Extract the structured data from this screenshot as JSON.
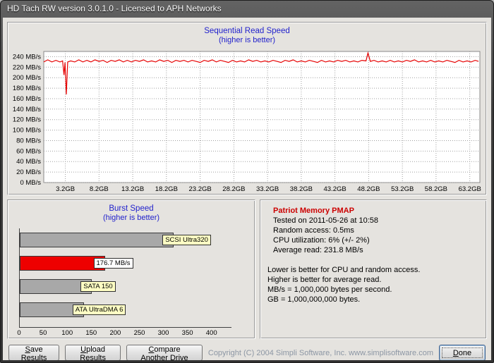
{
  "window": {
    "title": "HD Tach RW version 3.0.1.0 - Licensed to APH Networks"
  },
  "chart_data": [
    {
      "type": "line",
      "title": "Sequential Read Speed",
      "subtitle": "(higher is better)",
      "unit": "MB/s",
      "ylim": [
        0,
        250
      ],
      "yticks": [
        240,
        220,
        200,
        180,
        160,
        140,
        120,
        100,
        80,
        60,
        40,
        20,
        0
      ],
      "xlim": [
        0,
        64.7
      ],
      "xticks": [
        {
          "label": "3.2GB",
          "value": 3.2
        },
        {
          "label": "8.2GB",
          "value": 8.2
        },
        {
          "label": "13.2GB",
          "value": 13.2
        },
        {
          "label": "18.2GB",
          "value": 18.2
        },
        {
          "label": "23.2GB",
          "value": 23.2
        },
        {
          "label": "28.2GB",
          "value": 28.2
        },
        {
          "label": "33.2GB",
          "value": 33.2
        },
        {
          "label": "38.2GB",
          "value": 38.2
        },
        {
          "label": "43.2GB",
          "value": 43.2
        },
        {
          "label": "48.2GB",
          "value": 48.2
        },
        {
          "label": "53.2GB",
          "value": 53.2
        },
        {
          "label": "58.2GB",
          "value": 58.2
        },
        {
          "label": "63.2GB",
          "value": 63.2
        }
      ],
      "line_color": "#e60000",
      "grid": true,
      "points": [
        [
          0,
          230
        ],
        [
          0.6,
          234
        ],
        [
          1.2,
          230
        ],
        [
          1.8,
          233
        ],
        [
          2.4,
          230
        ],
        [
          2.8,
          232
        ],
        [
          3.0,
          205
        ],
        [
          3.15,
          229
        ],
        [
          3.35,
          168
        ],
        [
          3.55,
          230
        ],
        [
          4,
          232
        ],
        [
          4.6,
          230
        ],
        [
          5.2,
          234
        ],
        [
          5.8,
          230
        ],
        [
          6.4,
          233
        ],
        [
          7,
          230
        ],
        [
          7.6,
          234
        ],
        [
          8.2,
          231
        ],
        [
          8.8,
          233
        ],
        [
          9.4,
          229
        ],
        [
          10,
          233
        ],
        [
          10.6,
          231
        ],
        [
          11.2,
          234
        ],
        [
          11.8,
          230
        ],
        [
          12.4,
          233
        ],
        [
          13,
          230
        ],
        [
          13.6,
          233
        ],
        [
          14.2,
          231
        ],
        [
          14.8,
          234
        ],
        [
          15.4,
          230
        ],
        [
          16,
          232
        ],
        [
          16.6,
          230
        ],
        [
          17.2,
          234
        ],
        [
          17.8,
          231
        ],
        [
          18.4,
          233
        ],
        [
          19,
          229
        ],
        [
          19.6,
          233
        ],
        [
          20.2,
          231
        ],
        [
          20.8,
          233
        ],
        [
          21.4,
          230
        ],
        [
          22,
          233
        ],
        [
          22.6,
          231
        ],
        [
          23.2,
          229
        ],
        [
          23.8,
          233
        ],
        [
          24.4,
          231
        ],
        [
          25,
          234
        ],
        [
          25.6,
          230
        ],
        [
          26.2,
          233
        ],
        [
          26.8,
          231
        ],
        [
          27.4,
          229
        ],
        [
          28,
          233
        ],
        [
          28.6,
          230
        ],
        [
          29.2,
          232
        ],
        [
          29.8,
          230
        ],
        [
          30.4,
          234
        ],
        [
          31,
          231
        ],
        [
          31.6,
          233
        ],
        [
          32.2,
          230
        ],
        [
          32.8,
          232
        ],
        [
          33.4,
          230
        ],
        [
          34,
          233
        ],
        [
          34.6,
          231
        ],
        [
          35.2,
          229
        ],
        [
          35.8,
          233
        ],
        [
          36.4,
          231
        ],
        [
          37,
          234
        ],
        [
          37.6,
          230
        ],
        [
          38.2,
          232
        ],
        [
          38.8,
          230
        ],
        [
          39.4,
          233
        ],
        [
          40,
          231
        ],
        [
          40.6,
          229
        ],
        [
          41.2,
          233
        ],
        [
          41.8,
          230
        ],
        [
          42.4,
          232
        ],
        [
          43,
          230
        ],
        [
          43.6,
          233
        ],
        [
          44.2,
          231
        ],
        [
          44.8,
          233
        ],
        [
          45.4,
          230
        ],
        [
          46,
          232
        ],
        [
          46.6,
          230
        ],
        [
          47.2,
          233
        ],
        [
          47.8,
          232
        ],
        [
          48.1,
          247
        ],
        [
          48.45,
          231
        ],
        [
          49,
          233
        ],
        [
          49.6,
          230
        ],
        [
          50.2,
          232
        ],
        [
          50.8,
          230
        ],
        [
          51.4,
          233
        ],
        [
          52,
          230
        ],
        [
          52.6,
          232
        ],
        [
          53.2,
          230
        ],
        [
          53.8,
          233
        ],
        [
          54.4,
          231
        ],
        [
          55,
          234
        ],
        [
          55.6,
          230
        ],
        [
          56.2,
          232
        ],
        [
          56.8,
          230
        ],
        [
          57.4,
          233
        ],
        [
          58,
          230
        ],
        [
          58.6,
          232
        ],
        [
          59.2,
          230
        ],
        [
          59.8,
          233
        ],
        [
          60.4,
          231
        ],
        [
          61,
          229
        ],
        [
          61.6,
          233
        ],
        [
          62.2,
          230
        ],
        [
          62.8,
          232
        ],
        [
          63.4,
          230
        ],
        [
          64,
          233
        ],
        [
          64.5,
          231
        ]
      ]
    },
    {
      "type": "bar-horizontal",
      "title": "Burst Speed",
      "subtitle": "(higher is better)",
      "xlim": [
        0,
        440
      ],
      "xticks": [
        0,
        50,
        100,
        150,
        200,
        250,
        300,
        350,
        400
      ],
      "bars": [
        {
          "label": "SCSI Ultra320",
          "value": 320,
          "color": "#a8a8a8",
          "label_bg": "#ffffc4"
        },
        {
          "label": "176.7 MB/s",
          "value": 176.7,
          "color": "#ee0000",
          "label_bg": "#ffffff"
        },
        {
          "label": "SATA 150",
          "value": 150,
          "color": "#a8a8a8",
          "label_bg": "#ffffc4"
        },
        {
          "label": "ATA UltraDMA 6",
          "value": 133,
          "color": "#a8a8a8",
          "label_bg": "#ffffc4"
        }
      ]
    }
  ],
  "info": {
    "drive_name": "Patriot Memory PMAP",
    "lines": [
      "Tested on 2011-05-26 at 10:58",
      "Random access: 0.5ms",
      "CPU utilization: 6% (+/- 2%)",
      "Average read: 231.8 MB/s"
    ],
    "notes": [
      "Lower is better for CPU and random access.",
      "Higher is better for average read.",
      "MB/s = 1,000,000 bytes per second.",
      "GB = 1,000,000,000 bytes."
    ]
  },
  "footer": {
    "save_label": "Save Results",
    "upload_label": "Upload Results",
    "compare_label": "Compare Another Drive",
    "copyright": "Copyright (C) 2004 Simpli Software, Inc. www.simplisoftware.com",
    "done_label": "Done"
  }
}
